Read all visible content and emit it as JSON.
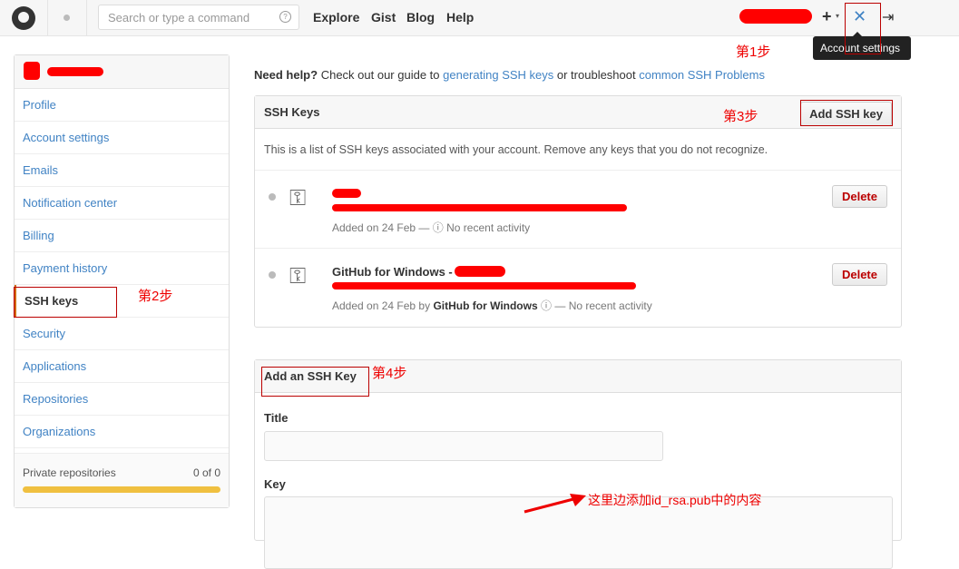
{
  "header": {
    "search_placeholder": "Search or type a command",
    "nav": [
      "Explore",
      "Gist",
      "Blog",
      "Help"
    ],
    "plus": "+",
    "tooltip": "Account settings"
  },
  "sidebar": {
    "items": [
      {
        "label": "Profile"
      },
      {
        "label": "Account settings"
      },
      {
        "label": "Emails"
      },
      {
        "label": "Notification center"
      },
      {
        "label": "Billing"
      },
      {
        "label": "Payment history"
      },
      {
        "label": "SSH keys",
        "selected": true
      },
      {
        "label": "Security"
      },
      {
        "label": "Applications"
      },
      {
        "label": "Repositories"
      },
      {
        "label": "Organizations"
      }
    ],
    "private_label": "Private repositories",
    "private_count": "0 of 0",
    "private_usage_fraction": 0
  },
  "help": {
    "prefix": "Need help?",
    "text1": "Check out our guide to",
    "link1": "generating SSH keys",
    "text2": "or troubleshoot",
    "link2": "common SSH Problems"
  },
  "ssh_keys": {
    "title": "SSH Keys",
    "add_button": "Add SSH key",
    "description": "This is a list of SSH keys associated with your account. Remove any keys that you do not recognize.",
    "keys": [
      {
        "title": "",
        "added": "Added on 24 Feb —",
        "by": "",
        "activity": "No recent activity",
        "delete": "Delete"
      },
      {
        "title": "GitHub for Windows -",
        "added": "Added on 24 Feb by",
        "by": "GitHub for Windows",
        "activity": "— No recent activity",
        "delete": "Delete"
      }
    ]
  },
  "add_key": {
    "title": "Add an SSH Key",
    "title_label": "Title",
    "title_value": "",
    "key_label": "Key",
    "key_value": ""
  },
  "annotations": {
    "step1": "第1步",
    "step2": "第2步",
    "step3": "第3步",
    "step4": "第4步",
    "note": "这里边添加id_rsa.pub中的内容"
  },
  "colors": {
    "link": "#4183c4",
    "annotation": "#e00000",
    "delete": "#bb0000"
  }
}
